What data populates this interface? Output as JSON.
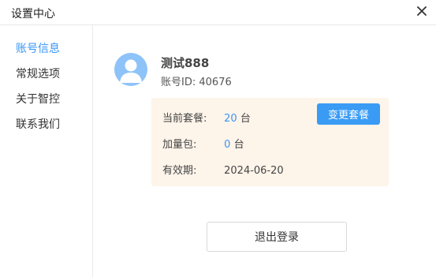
{
  "window": {
    "title": "设置中心",
    "close_icon": "close-icon"
  },
  "sidebar": {
    "items": [
      {
        "label": "账号信息",
        "active": true
      },
      {
        "label": "常规选项",
        "active": false
      },
      {
        "label": "关于智控",
        "active": false
      },
      {
        "label": "联系我们",
        "active": false
      }
    ]
  },
  "account": {
    "avatar_icon": "user-avatar-icon",
    "username": "测试888",
    "id_label": "账号ID:",
    "id_value": "40676"
  },
  "plan": {
    "current_label": "当前套餐:",
    "current_value": "20",
    "current_unit": "台",
    "addon_label": "加量包:",
    "addon_value": "0",
    "addon_unit": "台",
    "validity_label": "有效期:",
    "validity_value": "2024-06-20",
    "change_button": "变更套餐"
  },
  "actions": {
    "logout_button": "退出登录"
  },
  "colors": {
    "accent": "#3a96f5",
    "card_bg": "#fdf4ea",
    "avatar_bg": "#8ec3f9"
  }
}
